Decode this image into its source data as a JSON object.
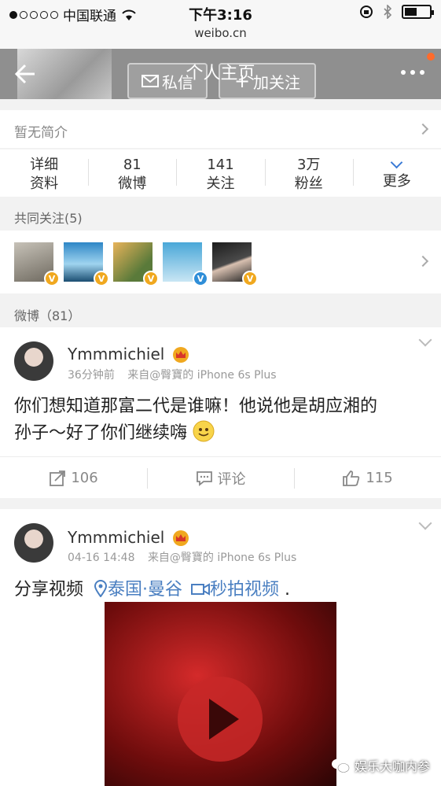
{
  "status_bar": {
    "carrier": "中国联通",
    "time": "下午3:16",
    "url": "weibo.cn"
  },
  "header": {
    "title": "个人主页",
    "message_label": "私信",
    "follow_label": "加关注"
  },
  "intro": {
    "text": "暂无简介"
  },
  "stats": [
    {
      "top": "详细",
      "bottom": "资料"
    },
    {
      "top": "81",
      "bottom": "微博"
    },
    {
      "top": "141",
      "bottom": "关注"
    },
    {
      "top": "3万",
      "bottom": "粉丝"
    },
    {
      "top": "",
      "bottom": "更多"
    }
  ],
  "common_follow": {
    "title": "共同关注(5)",
    "badge_colors": [
      "#f0a81f",
      "#f0a81f",
      "#f0a81f",
      "#2f8ed8",
      "#f0a81f"
    ]
  },
  "weibo_section": {
    "title": "微博（81）"
  },
  "posts": [
    {
      "user": "Ymmmichiel",
      "time": "36分钟前",
      "source": "来自@臀寶的 iPhone 6s Plus",
      "text_line1": "你们想知道那富二代是谁嘛！他说他是胡应湘的",
      "text_line2": "孙子～好了你们继续嗨",
      "repost_count": "106",
      "comment_label": "评论",
      "like_count": "115"
    },
    {
      "user": "Ymmmichiel",
      "time": "04-16 14:48",
      "source": "来自@臀寶的 iPhone 6s Plus",
      "text_prefix": "分享视频",
      "location": "泰国·曼谷",
      "video_link": "秒拍视频",
      "text_suffix": "."
    }
  ],
  "watermark": {
    "text": "娱乐大咖内参"
  },
  "colors": {
    "accent_blue": "#4a7fc1",
    "vip_gold": "#f0a81f"
  }
}
